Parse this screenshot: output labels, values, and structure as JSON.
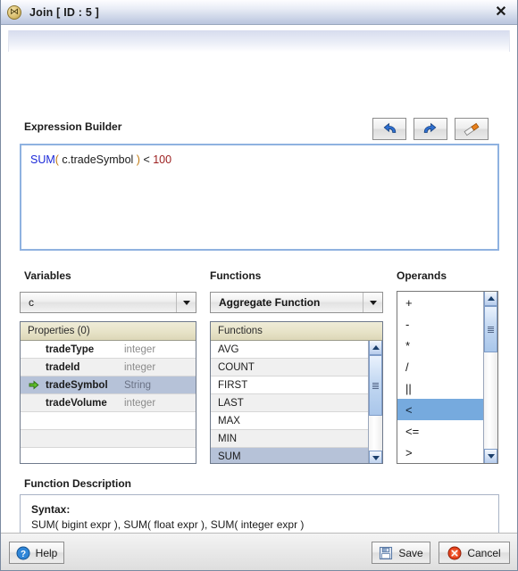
{
  "window": {
    "title": "Join [ ID : 5 ]",
    "icon": "join-bowtie-icon",
    "close_label": "✕"
  },
  "expression_builder": {
    "label": "Expression Builder",
    "tools": [
      {
        "name": "undo-button",
        "icon": "undo-arrow-icon",
        "label": "Undo"
      },
      {
        "name": "redo-button",
        "icon": "redo-arrow-icon",
        "label": "Redo"
      },
      {
        "name": "clear-button",
        "icon": "eraser-icon",
        "label": "Clear"
      }
    ],
    "expression_tokens": [
      {
        "text": "SUM",
        "kind": "fn"
      },
      {
        "text": "(",
        "kind": "par"
      },
      {
        "text": " c.tradeSymbol ",
        "kind": "var"
      },
      {
        "text": ")",
        "kind": "par"
      },
      {
        "text": " < ",
        "kind": "op"
      },
      {
        "text": "100",
        "kind": "num"
      }
    ],
    "expression_plain": "SUM( c.tradeSymbol ) < 100"
  },
  "variables": {
    "label": "Variables",
    "selected_variable": "c",
    "grid_header": "Properties (0)",
    "properties": [
      {
        "name": "tradeType",
        "type": "integer",
        "selected": false
      },
      {
        "name": "tradeId",
        "type": "integer",
        "selected": false
      },
      {
        "name": "tradeSymbol",
        "type": "String",
        "selected": true
      },
      {
        "name": "tradeVolume",
        "type": "integer",
        "selected": false
      }
    ],
    "empty_rows": 3
  },
  "functions": {
    "label": "Functions",
    "selected_category": "Aggregate Function",
    "grid_header": "Functions",
    "items": [
      {
        "name": "AVG",
        "selected": false
      },
      {
        "name": "COUNT",
        "selected": false
      },
      {
        "name": "FIRST",
        "selected": false
      },
      {
        "name": "LAST",
        "selected": false
      },
      {
        "name": "MAX",
        "selected": false
      },
      {
        "name": "MIN",
        "selected": false
      },
      {
        "name": "SUM",
        "selected": true
      }
    ]
  },
  "operands": {
    "label": "Operands",
    "items": [
      {
        "symbol": "+",
        "selected": false
      },
      {
        "symbol": "-",
        "selected": false
      },
      {
        "symbol": "*",
        "selected": false
      },
      {
        "symbol": "/",
        "selected": false
      },
      {
        "symbol": "||",
        "selected": false
      },
      {
        "symbol": "<",
        "selected": true
      },
      {
        "symbol": "<=",
        "selected": false
      },
      {
        "symbol": ">",
        "selected": false
      }
    ]
  },
  "function_description": {
    "label": "Function Description",
    "syntax_title": "Syntax:",
    "syntax_body": "SUM( bigint expr ), SUM( float expr ), SUM( integer expr )"
  },
  "footer": {
    "help_label": "Help",
    "save_label": "Save",
    "cancel_label": "Cancel"
  },
  "colors": {
    "accent_blue": "#76aade",
    "selection_gray": "#b6c2d8",
    "grid_header": "#e7e3c8",
    "token_function": "#1a28d8",
    "token_paren": "#c07a12",
    "token_number": "#9c2020"
  }
}
